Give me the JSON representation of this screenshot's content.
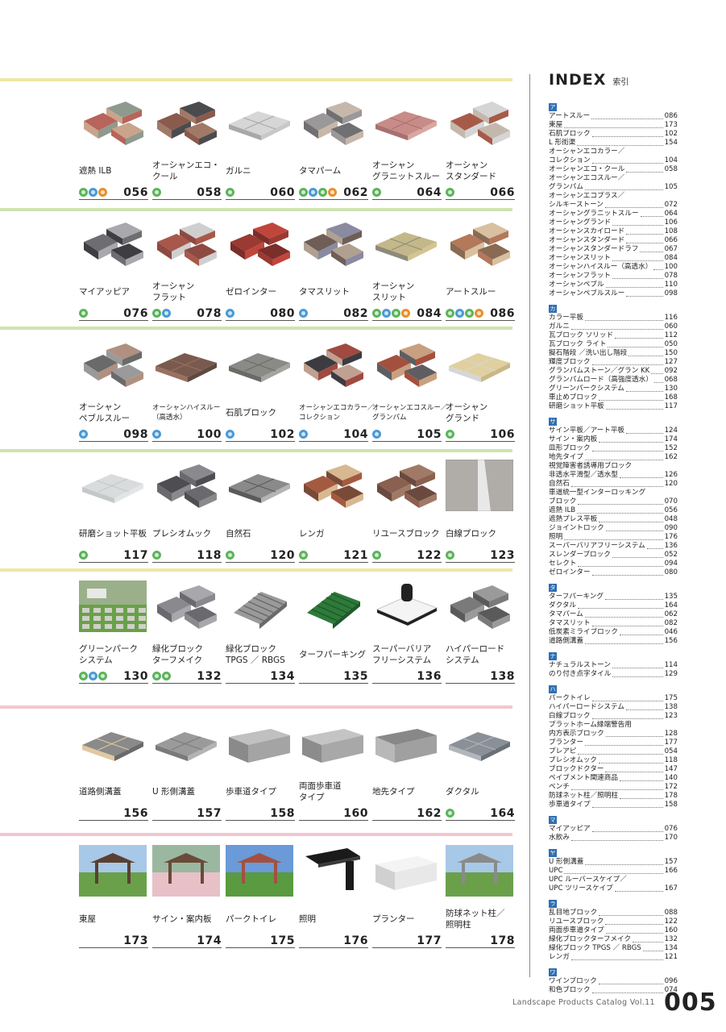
{
  "index": {
    "title": "INDEX",
    "subtitle": "索引",
    "groups": [
      {
        "kana": "ア",
        "entries": [
          [
            "アートスルー",
            "086"
          ],
          [
            "東屋",
            "173"
          ],
          [
            "石肌ブロック",
            "102"
          ],
          [
            "L 形街渠",
            "154"
          ],
          [
            "オーシャンエコカラー／",
            ""
          ],
          [
            "コレクション",
            "104"
          ],
          [
            "オーシャンエコ・クール",
            "058"
          ],
          [
            "オーシャンエコスルー／",
            ""
          ],
          [
            "グランパム",
            "105"
          ],
          [
            "オーシャンエコプラス／",
            ""
          ],
          [
            "シルキーストーン",
            "072"
          ],
          [
            "オーシャングラニットスルー",
            "064"
          ],
          [
            "オーシャングランド",
            "106"
          ],
          [
            "オーシャンスカイロード",
            "108"
          ],
          [
            "オーシャンスタンダード",
            "066"
          ],
          [
            "オーシャンスタンダードラフ",
            "067"
          ],
          [
            "オーシャンスリット",
            "084"
          ],
          [
            "オーシャンハイスルー（高透水）",
            "100"
          ],
          [
            "オーシャンフラット",
            "078"
          ],
          [
            "オーシャンペブル",
            "110"
          ],
          [
            "オーシャンペブルスルー",
            "098"
          ]
        ]
      },
      {
        "kana": "カ",
        "entries": [
          [
            "カラー平板",
            "116"
          ],
          [
            "ガルニ",
            "060"
          ],
          [
            "瓦ブロック ソリッド",
            "112"
          ],
          [
            "瓦ブロック ライト",
            "050"
          ],
          [
            "擬石階段 ／洗い出し階段",
            "150"
          ],
          [
            "輝度ブロック",
            "127"
          ],
          [
            "グランパムストーン／グラン KK",
            "092"
          ],
          [
            "グランパムロード（高強度透水）",
            "068"
          ],
          [
            "グリーンパークシステム",
            "130"
          ],
          [
            "車止めブロック",
            "168"
          ],
          [
            "研磨ショット平板",
            "117"
          ]
        ]
      },
      {
        "kana": "サ",
        "entries": [
          [
            "サイン平板／アート平板",
            "124"
          ],
          [
            "サイン・案内板",
            "174"
          ],
          [
            "皿形ブロック",
            "152"
          ],
          [
            "地先タイプ",
            "162"
          ],
          [
            "視覚障害者誘導用ブロック",
            ""
          ],
          [
            "非透水平滑型／透水型",
            "126"
          ],
          [
            "自然石",
            "120"
          ],
          [
            "車道統一型インターロッキング",
            ""
          ],
          [
            "ブロック",
            "070"
          ],
          [
            "遮熱 ILB",
            "056"
          ],
          [
            "遮熱プレス平板",
            "048"
          ],
          [
            "ジョイントロック",
            "090"
          ],
          [
            "照明",
            "176"
          ],
          [
            "スーパーバリアフリーシステム",
            "136"
          ],
          [
            "スレンダーブロック",
            "052"
          ],
          [
            "セレクト",
            "094"
          ],
          [
            "ゼロインター",
            "080"
          ]
        ]
      },
      {
        "kana": "タ",
        "entries": [
          [
            "ターフパーキング",
            "135"
          ],
          [
            "ダクタル",
            "164"
          ],
          [
            "タマパーム",
            "062"
          ],
          [
            "タマスリット",
            "082"
          ],
          [
            "低炭素ミライブロック",
            "046"
          ],
          [
            "道路側溝蓋",
            "156"
          ]
        ]
      },
      {
        "kana": "ナ",
        "entries": [
          [
            "ナチュラルストーン",
            "114"
          ],
          [
            "のり付き点字タイル",
            "129"
          ]
        ]
      },
      {
        "kana": "ハ",
        "entries": [
          [
            "パークトイレ",
            "175"
          ],
          [
            "ハイパーロードシステム",
            "138"
          ],
          [
            "白線ブロック",
            "123"
          ],
          [
            "プラットホーム縁端警告用",
            ""
          ],
          [
            "内方表示ブロック",
            "128"
          ],
          [
            "プランター",
            "177"
          ],
          [
            "プレアピ",
            "054"
          ],
          [
            "プレシオムック",
            "118"
          ],
          [
            "ブロックドクター",
            "147"
          ],
          [
            "ペイブメント関連商品",
            "140"
          ],
          [
            "ベンチ",
            "172"
          ],
          [
            "防球ネット柱／照明柱",
            "178"
          ],
          [
            "歩車道タイプ",
            "158"
          ]
        ]
      },
      {
        "kana": "マ",
        "entries": [
          [
            "マイアッピア",
            "076"
          ],
          [
            "水飲み",
            "170"
          ]
        ]
      },
      {
        "kana": "ヤ",
        "entries": [
          [
            "U 形側溝蓋",
            "157"
          ],
          [
            "UPC",
            "166"
          ],
          [
            "UPC ルーバースケイプ／",
            ""
          ],
          [
            "UPC ツリースケイプ",
            "167"
          ]
        ]
      },
      {
        "kana": "ラ",
        "entries": [
          [
            "乱目地ブロック",
            "088"
          ],
          [
            "リユースブロック",
            "122"
          ],
          [
            "両面歩車道タイプ",
            "160"
          ],
          [
            "緑化ブロックターフメイク",
            "132"
          ],
          [
            "緑化ブロック TPGS ／ RBGS",
            "134"
          ],
          [
            "レンガ",
            "121"
          ]
        ]
      },
      {
        "kana": "ワ",
        "entries": [
          [
            "ワインブロック",
            "096"
          ],
          [
            "和色ブロック",
            "074"
          ]
        ]
      }
    ]
  },
  "sections": [
    {
      "products": [
        {
          "name": [
            "遮熱 ILB"
          ],
          "icons": [
            "green",
            "blue",
            "orange"
          ],
          "page": "056",
          "visual": "blocks",
          "colors": [
            "#b8645a",
            "#8f9a8e",
            "#c9a48a"
          ]
        },
        {
          "name": [
            "オーシャンエコ・",
            "クール"
          ],
          "icons": [
            "green"
          ],
          "page": "058",
          "visual": "blocks",
          "colors": [
            "#8a5a4c",
            "#4b4b4e",
            "#a07a66"
          ]
        },
        {
          "name": [
            "ガルニ"
          ],
          "icons": [
            "green"
          ],
          "page": "060",
          "visual": "slabs",
          "colors": [
            "#d6d6d6",
            "#a8a8a8",
            "#c8c8c8"
          ]
        },
        {
          "name": [
            "タマパーム"
          ],
          "icons": [
            "green",
            "blue",
            "green",
            "orange"
          ],
          "page": "062",
          "visual": "blocks",
          "colors": [
            "#9a9898",
            "#c7b7aa",
            "#707072"
          ]
        },
        {
          "name": [
            "オーシャン",
            "グラニットスルー"
          ],
          "icons": [
            "green"
          ],
          "page": "064",
          "visual": "slabs",
          "colors": [
            "#c88c88",
            "#a87070",
            "#d9a7a1"
          ]
        },
        {
          "name": [
            "オーシャン",
            "スタンダード"
          ],
          "icons": [
            "green"
          ],
          "page": "066",
          "visual": "blocks",
          "colors": [
            "#a85a48",
            "#d5d5d5",
            "#c4b8ac"
          ]
        }
      ]
    },
    {
      "products": [
        {
          "name": [
            "マイアッピア"
          ],
          "icons": [
            "green"
          ],
          "page": "076",
          "visual": "blocks",
          "colors": [
            "#6e6e72",
            "#a9a9ad",
            "#3e3e42"
          ]
        },
        {
          "name": [
            "オーシャン",
            "フラット"
          ],
          "icons": [
            "green",
            "blue"
          ],
          "page": "078",
          "visual": "blocks",
          "colors": [
            "#a8584a",
            "#cfcfcf",
            "#8c4a42"
          ]
        },
        {
          "name": [
            "ゼロインター"
          ],
          "icons": [
            "blue"
          ],
          "page": "080",
          "visual": "blocks",
          "colors": [
            "#9a3a32",
            "#c0463c",
            "#7c2e2a"
          ]
        },
        {
          "name": [
            "タマスリット"
          ],
          "icons": [
            "blue"
          ],
          "page": "082",
          "visual": "blocks",
          "colors": [
            "#6e5e56",
            "#8a8aa0",
            "#b0a090"
          ]
        },
        {
          "name": [
            "オーシャン",
            "スリット"
          ],
          "icons": [
            "green",
            "blue",
            "green",
            "orange"
          ],
          "page": "084",
          "visual": "slabs",
          "colors": [
            "#c4b88a",
            "#8e8a7a",
            "#d4c490"
          ]
        },
        {
          "name": [
            "アートスルー"
          ],
          "icons": [
            "green",
            "blue",
            "green",
            "orange"
          ],
          "page": "086",
          "visual": "blocks",
          "colors": [
            "#b4785a",
            "#d8c0a0",
            "#8a6a52"
          ]
        }
      ]
    },
    {
      "products": [
        {
          "name": [
            "オーシャン",
            "ペブルスルー"
          ],
          "icons": [
            "blue"
          ],
          "page": "098",
          "visual": "blocks",
          "colors": [
            "#6a6a6a",
            "#b09080",
            "#9a9a9a"
          ]
        },
        {
          "name": [
            "オーシャンハイスルー",
            "（高透水）"
          ],
          "small": true,
          "icons": [
            "blue"
          ],
          "page": "100",
          "visual": "slabs",
          "colors": [
            "#7a5a4e",
            "#9a7060",
            "#5e4a40"
          ]
        },
        {
          "name": [
            "石肌ブロック"
          ],
          "icons": [
            "blue"
          ],
          "page": "102",
          "visual": "slabs",
          "colors": [
            "#8a8a86",
            "#6a6a66",
            "#a4a4a0"
          ]
        },
        {
          "name": [
            "オーシャンエコカラー／",
            "コレクション"
          ],
          "small": true,
          "icons": [
            "blue"
          ],
          "page": "104",
          "visual": "blocks",
          "colors": [
            "#3c3c40",
            "#a04a40",
            "#c0a090"
          ]
        },
        {
          "name": [
            "オーシャンエコスルー／",
            "グランパム"
          ],
          "small": true,
          "icons": [
            "blue"
          ],
          "page": "105",
          "visual": "blocks",
          "colors": [
            "#a4503e",
            "#c8a080",
            "#5e5e62"
          ]
        },
        {
          "name": [
            "オーシャン",
            "グランド"
          ],
          "icons": [
            "green"
          ],
          "page": "106",
          "visual": "slabs",
          "colors": [
            "#e0d0a0",
            "#d6d6d6",
            "#c8b888"
          ]
        }
      ]
    },
    {
      "products": [
        {
          "name": [
            "研磨ショット平板"
          ],
          "icons": [
            "green"
          ],
          "page": "117",
          "visual": "slabs",
          "colors": [
            "#d8dcdc",
            "#c4c8c8",
            "#e4e6e6"
          ]
        },
        {
          "name": [
            "プレシオムック"
          ],
          "icons": [
            "green"
          ],
          "page": "118",
          "visual": "blocks",
          "colors": [
            "#4e4e52",
            "#8a8a8e",
            "#6a6a6e"
          ]
        },
        {
          "name": [
            "自然石"
          ],
          "icons": [
            "green"
          ],
          "page": "120",
          "visual": "slabs",
          "colors": [
            "#8a8a8a",
            "#5a5a5a",
            "#b4b4b4"
          ]
        },
        {
          "name": [
            "レンガ"
          ],
          "icons": [
            "green"
          ],
          "page": "121",
          "visual": "blocks",
          "colors": [
            "#a45a40",
            "#d8b890",
            "#7a4a38"
          ]
        },
        {
          "name": [
            "リユースブロック"
          ],
          "icons": [
            "green"
          ],
          "page": "122",
          "visual": "blocks",
          "colors": [
            "#8a6050",
            "#a07a66",
            "#6a4a40"
          ]
        },
        {
          "name": [
            "白線ブロック"
          ],
          "icons": [
            "green"
          ],
          "page": "123",
          "visual": "road",
          "colors": [
            "#b0aca8",
            "#e8e8e8",
            "#8a8884"
          ]
        }
      ]
    },
    {
      "products": [
        {
          "name": [
            "グリーンパーク",
            "システム"
          ],
          "icons": [
            "green",
            "blue",
            "green"
          ],
          "page": "130",
          "visual": "grass",
          "colors": [
            "#6aa04a",
            "#d0d0c8",
            "#3a6a30"
          ]
        },
        {
          "name": [
            "緑化ブロック",
            "ターフメイク"
          ],
          "icons": [
            "green",
            "green"
          ],
          "page": "132",
          "visual": "blocks",
          "colors": [
            "#8a8a8e",
            "#a8a8ac",
            "#6a6a6e"
          ]
        },
        {
          "name": [
            "緑化ブロック",
            "TPGS ／ RBGS"
          ],
          "icons": [],
          "page": "134",
          "visual": "grid",
          "colors": [
            "#9a9a9a",
            "#b8b8b8",
            "#6a6a6a"
          ]
        },
        {
          "name": [
            "ターフパーキング"
          ],
          "icons": [],
          "page": "135",
          "visual": "grid",
          "colors": [
            "#2e7a3a",
            "#4aa050",
            "#1e5a2a"
          ]
        },
        {
          "name": [
            "スーパーバリア",
            "フリーシステム"
          ],
          "icons": [],
          "page": "136",
          "visual": "frame",
          "colors": [
            "#c8c8c8",
            "#222222",
            "#f4f4f4"
          ]
        },
        {
          "name": [
            "ハイパーロード",
            "システム"
          ],
          "icons": [],
          "page": "138",
          "visual": "blocks",
          "colors": [
            "#7a7a7a",
            "#9a9a9a",
            "#5a5a5a"
          ]
        }
      ]
    },
    {
      "products": [
        {
          "name": [
            "道路側溝蓋"
          ],
          "icons": [],
          "page": "156",
          "visual": "slabs",
          "colors": [
            "#8a8a8a",
            "#e0c8a0",
            "#6a6a6a"
          ]
        },
        {
          "name": [
            "U 形側溝蓋"
          ],
          "icons": [],
          "page": "157",
          "visual": "slabs",
          "colors": [
            "#9a9a9a",
            "#7a7a7a",
            "#b4b4b4"
          ]
        },
        {
          "name": [
            "歩車道タイプ"
          ],
          "icons": [],
          "page": "158",
          "visual": "curb",
          "colors": [
            "#a4a4a4",
            "#8a8a8a",
            "#c0c0c0"
          ]
        },
        {
          "name": [
            "両面歩車道",
            "タイプ"
          ],
          "icons": [],
          "page": "160",
          "visual": "curb",
          "colors": [
            "#a8a8a8",
            "#8c8c8c",
            "#c4c4c4"
          ]
        },
        {
          "name": [
            "地先タイプ"
          ],
          "icons": [],
          "page": "162",
          "visual": "curb",
          "colors": [
            "#a0a0a0",
            "#b8b8b8",
            "#888888"
          ]
        },
        {
          "name": [
            "ダクタル"
          ],
          "icons": [
            "green"
          ],
          "page": "164",
          "visual": "slabs",
          "colors": [
            "#8a9098",
            "#b0b6bc",
            "#6a7078"
          ]
        }
      ]
    },
    {
      "products": [
        {
          "name": [
            "東屋"
          ],
          "icons": [],
          "page": "173",
          "visual": "scene",
          "colors": [
            "#5a4030",
            "#6aa04a",
            "#a8c8e8"
          ]
        },
        {
          "name": [
            "サイン・案内板"
          ],
          "icons": [],
          "page": "174",
          "visual": "scene",
          "colors": [
            "#6a4a3a",
            "#e8c0c8",
            "#9ab8a0"
          ]
        },
        {
          "name": [
            "パークトイレ"
          ],
          "icons": [],
          "page": "175",
          "visual": "scene",
          "colors": [
            "#a45040",
            "#5a9a40",
            "#6a9ad8"
          ]
        },
        {
          "name": [
            "照明"
          ],
          "icons": [],
          "page": "176",
          "visual": "lamp",
          "colors": [
            "#1a1a1a",
            "#3a3a3a",
            "#ffffff"
          ]
        },
        {
          "name": [
            "プランター"
          ],
          "icons": [],
          "page": "177",
          "visual": "curb",
          "colors": [
            "#e8e8e8",
            "#d0d0d0",
            "#f4f4f4"
          ]
        },
        {
          "name": [
            "防球ネット柱／",
            "照明柱"
          ],
          "icons": [],
          "page": "178",
          "visual": "scene",
          "colors": [
            "#8a8a8a",
            "#6aa04a",
            "#a8c8e8"
          ]
        }
      ]
    }
  ],
  "footer": {
    "catalog": "Landscape Products Catalog Vol.11",
    "page_number": "005"
  }
}
